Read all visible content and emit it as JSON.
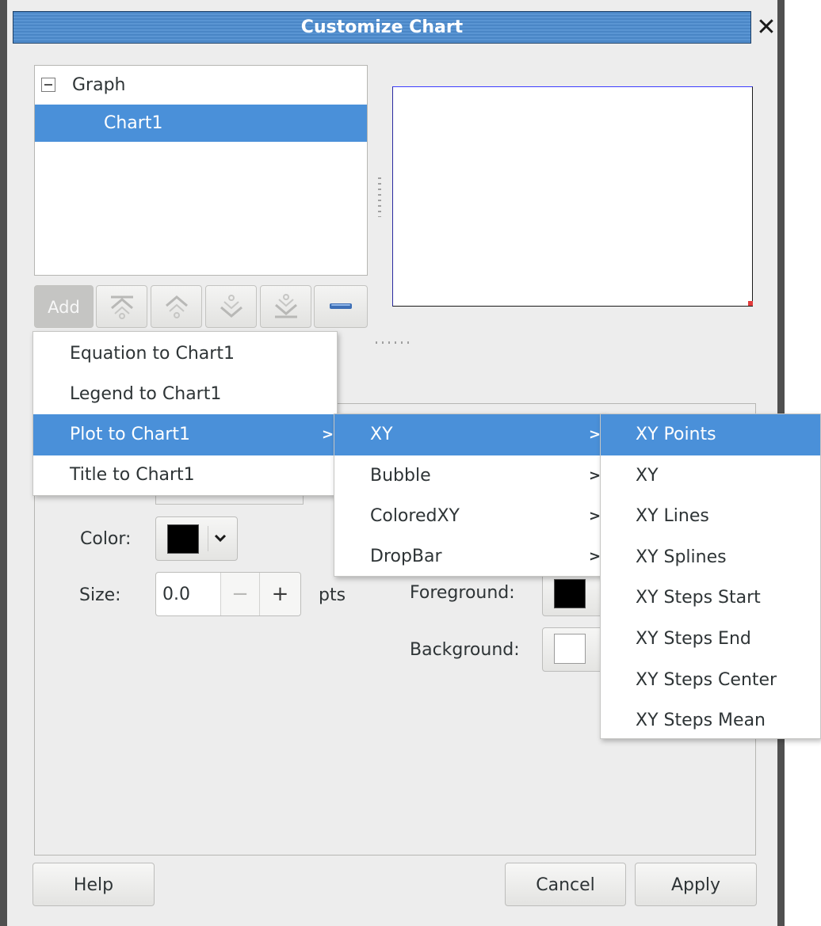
{
  "window": {
    "title": "Customize Chart",
    "close_icon": "close-icon"
  },
  "tree": {
    "root_label": "Graph",
    "child_label": "Chart1"
  },
  "toolbar": {
    "add_label": "Add",
    "icons": [
      "move-to-top-icon",
      "move-up-icon",
      "move-down-icon",
      "move-to-bottom-icon",
      "remove-icon"
    ]
  },
  "properties": {
    "color_label": "Color:",
    "size_label": "Size:",
    "size_value": "0.0",
    "size_unit": "pts",
    "minus_label": "−",
    "plus_label": "+",
    "foreground_label": "Foreground:",
    "background_label": "Background:",
    "colors": {
      "line_color": "#000000",
      "foreground": "#000000",
      "background": "#ffffff"
    },
    "dropdown_icon": "chevron-down-icon"
  },
  "menus": {
    "add_menu": [
      {
        "label": "Equation to Chart1"
      },
      {
        "label": "Legend to Chart1"
      },
      {
        "label": "Plot to Chart1",
        "submenu": true,
        "selected": true
      },
      {
        "label": "Title to Chart1"
      }
    ],
    "plot_menu": [
      {
        "label": "XY",
        "submenu": true,
        "selected": true
      },
      {
        "label": "Bubble",
        "submenu": true
      },
      {
        "label": "ColoredXY",
        "submenu": true
      },
      {
        "label": "DropBar",
        "submenu": true
      }
    ],
    "xy_menu": [
      {
        "label": "XY Points",
        "selected": true
      },
      {
        "label": "XY"
      },
      {
        "label": "XY Lines"
      },
      {
        "label": "XY Splines"
      },
      {
        "label": "XY Steps Start"
      },
      {
        "label": "XY Steps End"
      },
      {
        "label": "XY Steps Center"
      },
      {
        "label": "XY Steps Mean"
      }
    ],
    "submenu_arrow": ">"
  },
  "buttons": {
    "help": "Help",
    "cancel": "Cancel",
    "apply": "Apply"
  },
  "accent_color": "#4a90d9"
}
